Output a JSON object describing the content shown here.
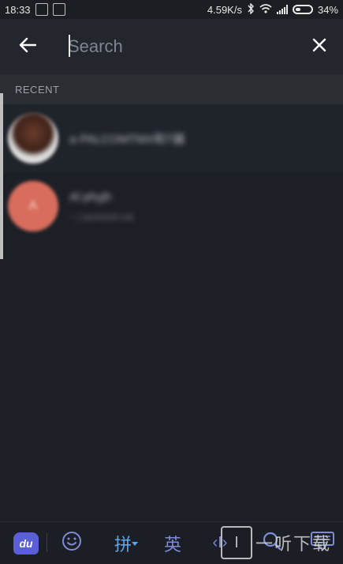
{
  "status_bar": {
    "time": "18:33",
    "network_speed": "4.59K/s",
    "battery_percent": "34%",
    "battery_level": 0.34
  },
  "search": {
    "placeholder": "Search",
    "value": ""
  },
  "recent": {
    "header": "RECENT",
    "items": [
      {
        "name": "a·PALCOMTMX和T器",
        "subtitle": "",
        "avatar_type": "photo"
      },
      {
        "name": "Al phyjh",
        "subtitle": "~ | tanhhh/h k/k",
        "avatar_type": "initials",
        "avatar_letter": "A",
        "avatar_color": "#d86d5d"
      }
    ]
  },
  "keyboard": {
    "logo": "du",
    "pinyin_label": "拼",
    "english_label": "英",
    "cursor_label": "‹I›"
  },
  "watermark": {
    "glyph": "I",
    "text": "一听下载"
  },
  "colors": {
    "background": "#1c2026",
    "search_bar": "#23272d",
    "accent_keyboard": "#5aa8f0",
    "avatar_initials": "#d86d5d"
  }
}
